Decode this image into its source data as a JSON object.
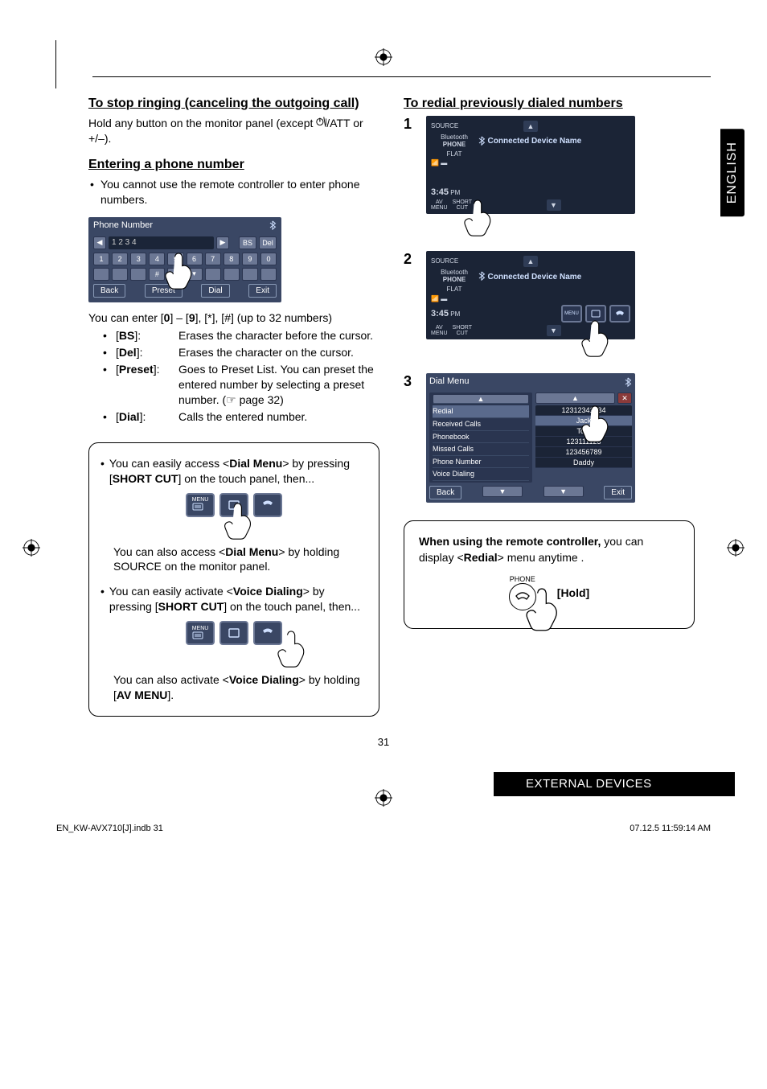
{
  "language_tab": "ENGLISH",
  "left": {
    "h_cancel": "To stop ringing (canceling the outgoing call)",
    "p_cancel_pre": "Hold any button on the monitor panel (except ",
    "p_cancel_post": "/ATT or +/–).",
    "h_enter": "Entering a phone number",
    "p_enter": "You cannot use the remote controller to enter phone numbers.",
    "phone_ui": {
      "title": "Phone Number",
      "value": "1 2 3 4",
      "bs": "BS",
      "del": "Del",
      "keys": [
        "1",
        "2",
        "3",
        "4",
        "5",
        "6",
        "7",
        "8",
        "9",
        "0",
        " ",
        " ",
        " ",
        "#",
        " ",
        "▾",
        " ",
        " ",
        " ",
        " "
      ],
      "back": "Back",
      "preset": "Preset",
      "dial": "Dial",
      "exit": "Exit"
    },
    "p_after_ui": "You can enter [0] – [9], [*], [#] (up to 32 numbers)",
    "defs": [
      {
        "k": "[BS]:",
        "v": "Erases the character before the cursor."
      },
      {
        "k": "[Del]:",
        "v": "Erases the character on the cursor."
      },
      {
        "k": "[Preset]:",
        "v": "Goes to Preset List. You can preset the entered number by selecting a preset number. (☞ page 32)"
      },
      {
        "k": "[Dial]:",
        "v": "Calls the entered number."
      }
    ],
    "box": {
      "b1_pre": "You can easily access <",
      "b1_bold": "Dial Menu",
      "b1_mid": "> by pressing [",
      "b1_bold2": "SHORT CUT",
      "b1_post": "] on the touch panel, then...",
      "p_also1_pre": "You can also access <",
      "p_also1_bold": "Dial Menu",
      "p_also1_post": "> by holding SOURCE on the monitor panel.",
      "b2_pre": "You can easily activate <",
      "b2_bold": "Voice Dialing",
      "b2_mid": "> by pressing [",
      "b2_bold2": "SHORT CUT",
      "b2_post": "] on the touch panel, then...",
      "p_also2_pre": "You can also activate <",
      "p_also2_bold": "Voice Dialing",
      "p_also2_post": "> by holding [",
      "p_also2_bold2": "AV MENU",
      "p_also2_post2": "]."
    }
  },
  "right": {
    "h_redial": "To redial previously dialed numbers",
    "step1num": "1",
    "step2num": "2",
    "step3num": "3",
    "device": {
      "source": "SOURCE",
      "bt": "Bluetooth",
      "phone": "PHONE",
      "label": "Connected Device Name",
      "flat": "FLAT",
      "time": "3:45",
      "ampm": "PM",
      "avmenu": "AV\nMENU",
      "shortcut": "SHORT\nCUT",
      "menubtn": "MENU"
    },
    "dialmenu": {
      "title": "Dial Menu",
      "list": [
        "Redial",
        "Received Calls",
        "Phonebook",
        "Missed Calls",
        "Phone Number",
        "Voice Dialing"
      ],
      "entries": [
        "12312341234",
        "Jack",
        "Tom",
        "123111123",
        "123456789",
        "Daddy"
      ],
      "back": "Back",
      "exit": "Exit"
    },
    "box2": {
      "p_pre": "When using the remote controller,",
      "p_mid": " you can display <",
      "p_bold": "Redial",
      "p_post": "> menu anytime .",
      "phone": "PHONE",
      "hold": "[Hold]"
    }
  },
  "footer": {
    "bar": "EXTERNAL DEVICES",
    "page": "31",
    "left": "EN_KW-AVX710[J].indb   31",
    "right": "07.12.5   11:59:14 AM"
  }
}
